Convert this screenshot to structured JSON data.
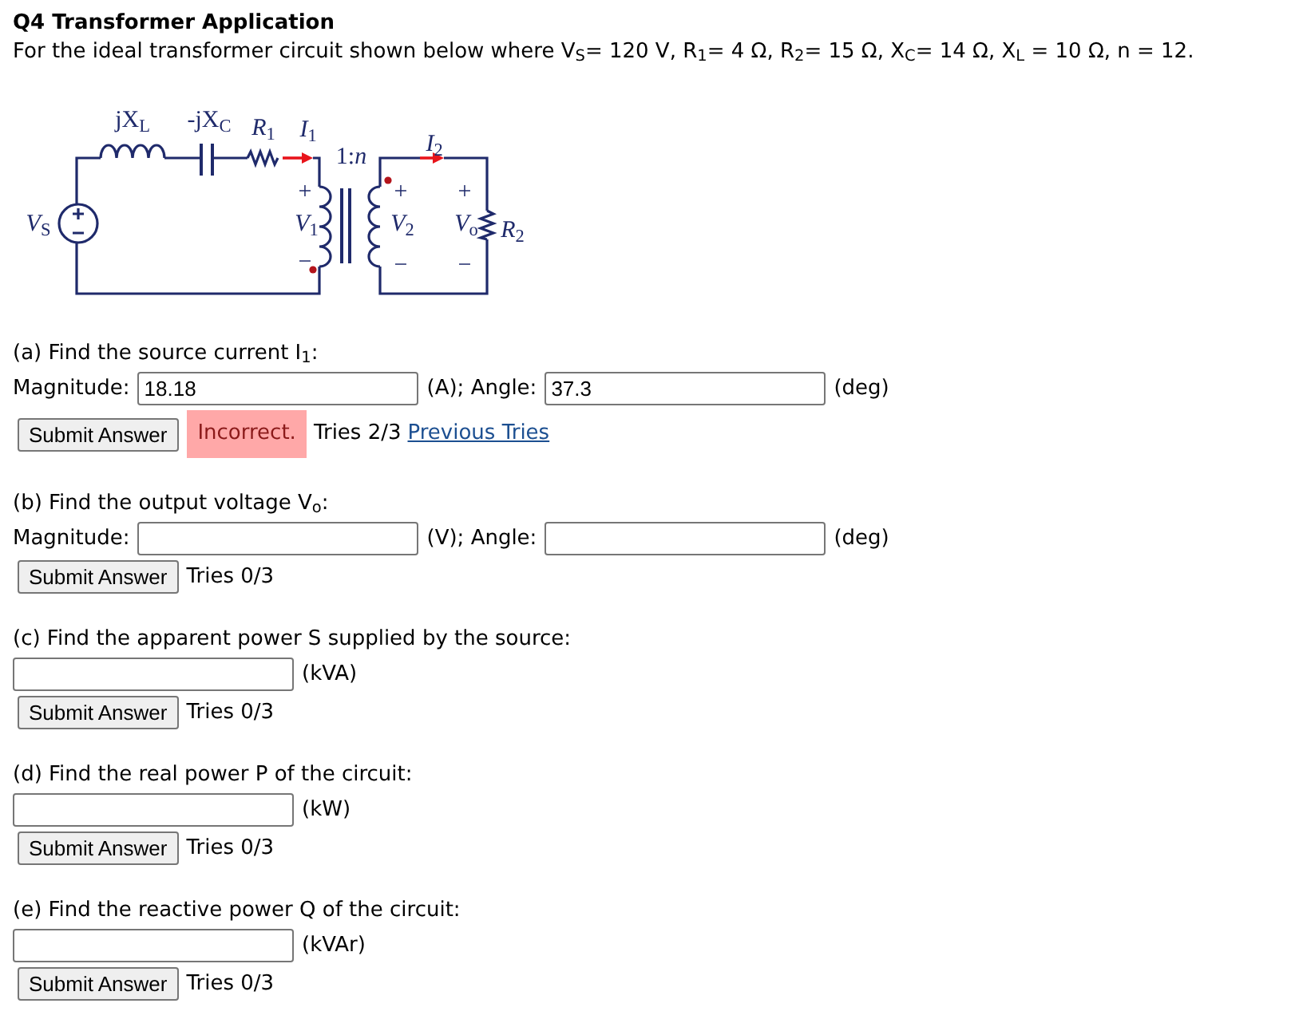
{
  "title": "Q4 Transformer Application",
  "intro": "For the ideal transformer circuit shown below where V$_{S}$= 120 V, R$_{1}$= 4 Ω, R$_{2}$= 15 Ω, X$_{C}$= 14 Ω, X$_{L}$ = 10 Ω, n = 12.",
  "circuit": {
    "labels": [
      "jX$_{L}$",
      "-jX$_{C}$",
      "*R*$_{1}$",
      "*I*$_{1}$",
      "1:*n*",
      "*I*$_{2}$",
      "*V*$_{S}$",
      "+",
      "*V*$_{1}$",
      "−",
      "+",
      "*V*$_{2}$",
      "−",
      "+",
      "*V*$_{o}$",
      "*R*$_{2}$",
      "−"
    ]
  },
  "parts": [
    {
      "prompt": "(a) Find the source current I$_{1}$:",
      "answer_row": [
        {
          "kind": "label",
          "text": "Magnitude:"
        },
        {
          "kind": "input",
          "value": "18.18"
        },
        {
          "kind": "label",
          "text": "(A); Angle:"
        },
        {
          "kind": "input",
          "value": "37.3"
        },
        {
          "kind": "label",
          "text": "(deg)"
        }
      ],
      "submit": "Submit Answer",
      "feedback": {
        "kind": "incorrect",
        "text": "Incorrect."
      },
      "tries": "Tries 2/3",
      "previous_tries": "Previous Tries"
    },
    {
      "prompt": "(b) Find the output voltage V$_{o}$:",
      "answer_row": [
        {
          "kind": "label",
          "text": "Magnitude:"
        },
        {
          "kind": "input"
        },
        {
          "kind": "label",
          "text": "(V); Angle:"
        },
        {
          "kind": "input"
        },
        {
          "kind": "label",
          "text": "(deg)"
        }
      ],
      "submit": "Submit Answer",
      "tries": "Tries 0/3"
    },
    {
      "prompt": "(c) Find the apparent power S supplied by the source:",
      "answer_row": [
        {
          "kind": "input"
        },
        {
          "kind": "label",
          "text": "(kVA)"
        }
      ],
      "submit": "Submit Answer",
      "tries": "Tries 0/3"
    },
    {
      "prompt": "(d) Find the real power P of the circuit:",
      "answer_row": [
        {
          "kind": "input"
        },
        {
          "kind": "label",
          "text": "(kW)"
        }
      ],
      "submit": "Submit Answer",
      "tries": "Tries 0/3"
    },
    {
      "prompt": "(e) Find the reactive power Q of the circuit:",
      "answer_row": [
        {
          "kind": "input"
        },
        {
          "kind": "label",
          "text": "(kVAr)"
        }
      ],
      "submit": "Submit Answer",
      "tries": "Tries 0/3"
    }
  ]
}
